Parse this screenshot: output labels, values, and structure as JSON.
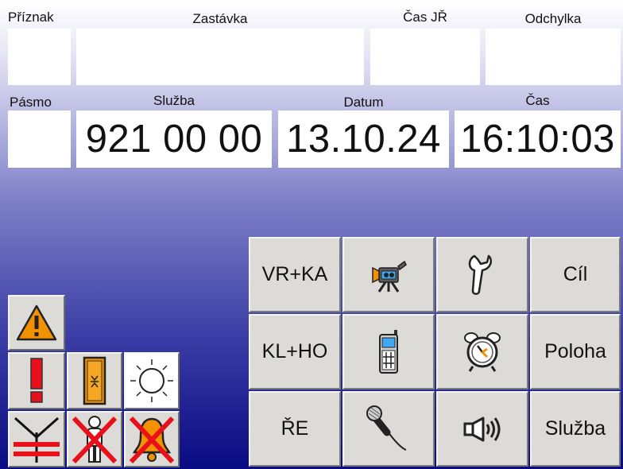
{
  "header": {
    "priznak_label": "Příznak",
    "zastavka_label": "Zastávka",
    "cas_jr_label": "Čas JŘ",
    "odchylka_label": "Odchylka",
    "pasmo_label": "Pásmo",
    "sluzba_label": "Služba",
    "datum_label": "Datum",
    "cas_label": "Čas"
  },
  "values": {
    "priznak": "",
    "zastavka": "",
    "cas_jr": "",
    "odchylka": "",
    "pasmo": "",
    "sluzba": "921 00 00",
    "datum": "13.10.24",
    "cas": "16:10:03"
  },
  "buttons": {
    "vr_ka": "VR+KA",
    "kl_ho": "KL+HO",
    "re": "ŘE",
    "cil": "Cíl",
    "poloha": "Poloha",
    "sluzba": "Služba"
  },
  "icons": {
    "camera": "video-camera-icon",
    "wrench": "wrench-icon",
    "phone": "mobile-phone-icon",
    "alarm": "alarm-clock-icon",
    "microphone": "microphone-icon",
    "speaker": "speaker-icon",
    "warning": "warning-triangle-icon",
    "exclamation": "exclamation-icon",
    "door": "door-icon",
    "brightness": "sun-icon",
    "antenna_off": "antenna-crossed-icon",
    "passenger_off": "passenger-crossed-icon",
    "bell_off": "bell-crossed-icon"
  },
  "colors": {
    "button_face": "#dcdbd8",
    "warning_orange": "#f29200",
    "alert_red": "#e8101a",
    "bg_dark": "#090b82"
  }
}
